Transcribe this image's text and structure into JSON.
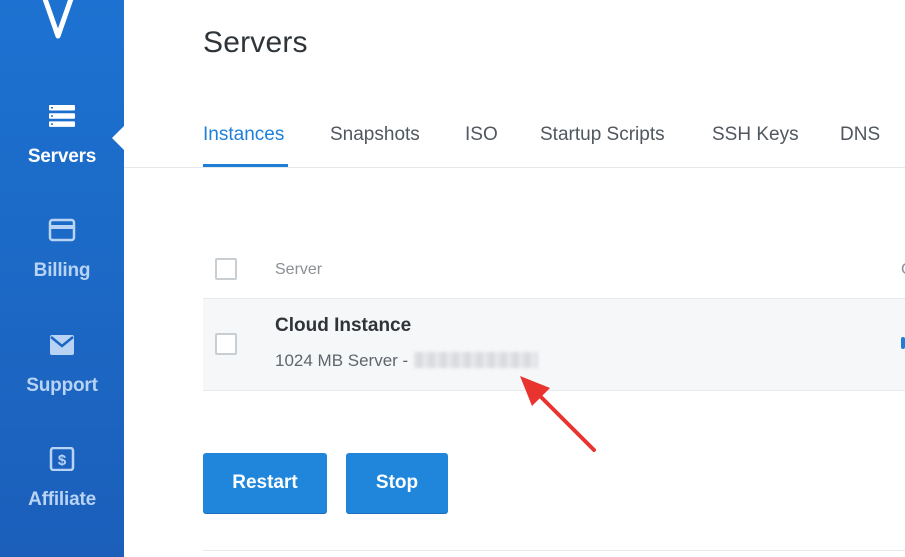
{
  "sidebar": {
    "logo": "vultr-v-logo",
    "items": [
      {
        "label": "Servers",
        "icon": "server-stack-icon",
        "active": true
      },
      {
        "label": "Billing",
        "icon": "credit-card-icon",
        "active": false
      },
      {
        "label": "Support",
        "icon": "envelope-icon",
        "active": false
      },
      {
        "label": "Affiliate",
        "icon": "dollar-tag-icon",
        "active": false
      }
    ]
  },
  "page": {
    "title": "Servers"
  },
  "tabs": [
    {
      "label": "Instances",
      "active": true
    },
    {
      "label": "Snapshots",
      "active": false
    },
    {
      "label": "ISO",
      "active": false
    },
    {
      "label": "Startup Scripts",
      "active": false
    },
    {
      "label": "SSH Keys",
      "active": false
    },
    {
      "label": "DNS",
      "active": false
    }
  ],
  "table": {
    "columns": [
      "Server",
      "C"
    ],
    "rows": [
      {
        "name": "Cloud Instance",
        "description": "1024 MB Server -",
        "ip_redacted": true
      }
    ]
  },
  "actions": {
    "restart_label": "Restart",
    "stop_label": "Stop"
  },
  "colors": {
    "sidebar": "#1d72d1",
    "accent": "#1f7fd8",
    "button": "#1f86dc",
    "annotation_arrow": "#e8332f"
  }
}
